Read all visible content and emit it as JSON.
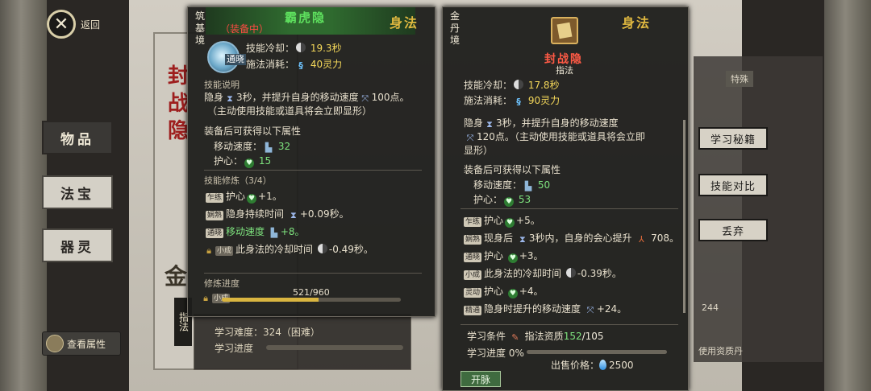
{
  "nav": {
    "back_label": "返回",
    "tabs": [
      "物品",
      "法宝",
      "器灵"
    ],
    "view_attributes": "查看属性"
  },
  "background": {
    "scroll_title": "封战隐",
    "scroll_gold_char": "金",
    "scroll_vertical_tag": "指法",
    "difficulty_label": "学习难度：",
    "difficulty_value": "324（困难）",
    "progress_label": "学习进度",
    "right_tab_text": "特殊",
    "right_number": "244",
    "right_bottom_text": "使用资质丹"
  },
  "side_buttons": [
    "学习秘籍",
    "技能对比",
    "丢弃"
  ],
  "left_panel": {
    "realm": "筑基境",
    "equip_status": "（装备中）",
    "skill_name": "霸虎隐",
    "school": "身法",
    "icon_badge": "通晓",
    "cooldown_label": "技能冷却：",
    "cooldown_value": "19.3秒",
    "cost_label": "施法消耗：",
    "cost_value": "40灵力",
    "desc_title": "技能说明",
    "desc_line1_a": "隐身",
    "desc_line1_b": "3秒，并提升自身的移动速度",
    "desc_line1_c": "100点。",
    "desc_line2": "（主动使用技能或道具将会立即显形）",
    "equip_attr_title": "装备后可获得以下属性",
    "move_speed_label": "移动速度：",
    "move_speed_value": "32",
    "guard_label": "护心：",
    "guard_value": "15",
    "cultivation_title": "技能修炼（3/4）",
    "mods": [
      {
        "tier": "乍练",
        "label": "护心",
        "value": "+1。"
      },
      {
        "tier": "娴熟",
        "label": "隐身持续时间",
        "value": "+0.09秒。"
      },
      {
        "tier": "通晓",
        "label": "移动速度",
        "value": "+8。"
      },
      {
        "tier": "小成",
        "label": "此身法的冷却时间",
        "value": "-0.49秒。"
      }
    ],
    "progress_title": "修炼进度",
    "progress_text": "521/960",
    "progress_fraction": 0.5427,
    "progress_level": "小成"
  },
  "right_panel": {
    "realm": "金丹境",
    "skill_name": "封战隐",
    "school": "身法",
    "school_sub": "指法",
    "cooldown_label": "技能冷却：",
    "cooldown_value": "17.8秒",
    "cost_label": "施法消耗：",
    "cost_value": "90灵力",
    "desc_line1_a": "隐身",
    "desc_line1_b": "3秒，并提升自身的移动速度",
    "desc_line2_a": "120点。（主动使用技能或道具将会立即",
    "desc_line3": "显形）",
    "equip_attr_title": "装备后可获得以下属性",
    "move_speed_label": "移动速度：",
    "move_speed_value": "50",
    "guard_label": "护心：",
    "guard_value": "53",
    "mods": [
      {
        "tier": "乍练",
        "label": "护心",
        "value": "+5。"
      },
      {
        "tier": "娴熟",
        "label": "现身后",
        "extra": "3秒内，自身的会心提升",
        "value": "708。"
      },
      {
        "tier": "通晓",
        "label": "护心",
        "value": "+3。"
      },
      {
        "tier": "小成",
        "label": "此身法的冷却时间",
        "value": "-0.39秒。"
      },
      {
        "tier": "灵动",
        "label": "护心",
        "value": "+4。"
      },
      {
        "tier": "精通",
        "label": "隐身时提升的移动速度",
        "value": "+24。"
      }
    ],
    "learn_cond_label": "学习条件",
    "learn_cond_text": "指法资质",
    "learn_cond_current": "152",
    "learn_cond_total": "/105",
    "learn_progress_label": "学习进度",
    "learn_progress_value": "0%",
    "learn_progress_fraction": 0,
    "sell_price_label": "出售价格：",
    "sell_price_value": "2500",
    "bottom_button": "开脉"
  }
}
